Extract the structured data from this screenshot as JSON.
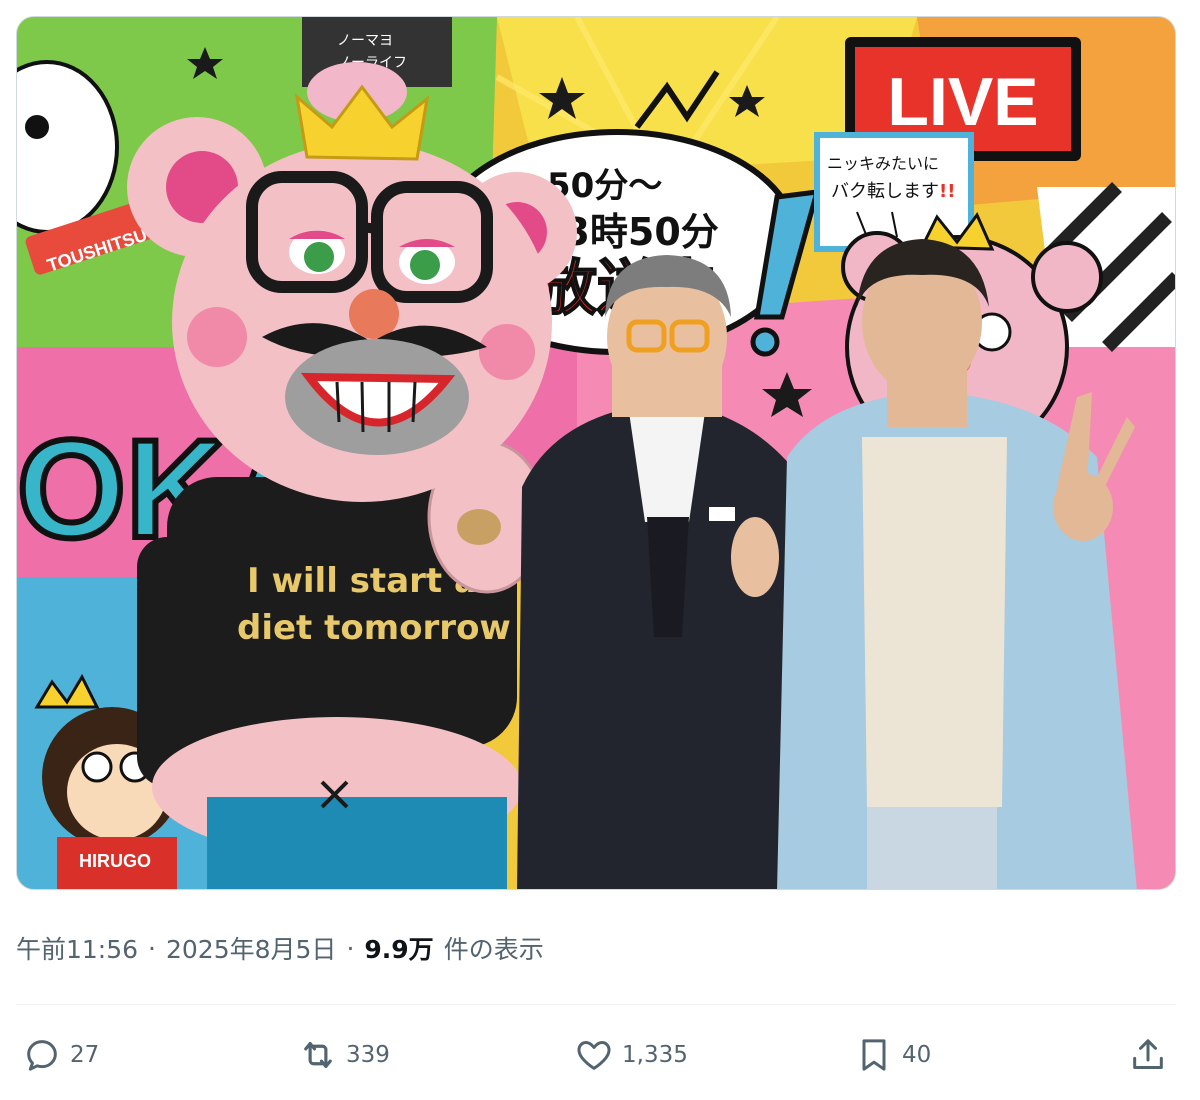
{
  "photo": {
    "badge_live": "LIVE",
    "banner_time_1": "50分〜",
    "banner_time_2": "13時50分",
    "banner_onair": "放送中",
    "sign_line1": "ニッキみたいに",
    "sign_line2": "バク転します",
    "sign_exclaim": "!!",
    "shirt_line1": "I will start a",
    "shirt_line2": "diet tomorrow",
    "wall_letters": "OKA",
    "char_tag_1": "TOUSHITSU",
    "char_tag_2": "HIRUGO",
    "top_char_text_1": "ノーマヨ",
    "top_char_text_2": "ノーライフ"
  },
  "meta": {
    "time": "午前11:56",
    "separator": "·",
    "date": "2025年8月5日",
    "views_count": "9.9万",
    "views_label": "件の表示"
  },
  "actions": {
    "reply_count": "27",
    "repost_count": "339",
    "like_count": "1,335",
    "bookmark_count": "40"
  },
  "colors": {
    "text_secondary": "#536471",
    "text_primary": "#0f1419",
    "live_red": "#e8332a"
  }
}
